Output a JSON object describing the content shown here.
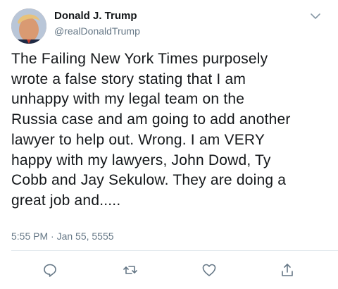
{
  "tweet": {
    "author": {
      "display_name": "Donald J. Trump",
      "handle": "@realDonaldTrump"
    },
    "text": "The Failing New York Times purposely\nwrote a false story stating that I am\nunhappy with my legal team on the\nRussia case and am going to add another\nlawyer to help out. Wrong. I am VERY\nhappy with my lawyers, John Dowd, Ty\nCobb and Jay Sekulow. They are doing a\ngreat job and.....",
    "timestamp": "5:55 PM · Jan 55, 5555"
  },
  "icons": {
    "menu": "chevron-down-icon",
    "reply": "reply-icon",
    "retweet": "retweet-icon",
    "like": "like-icon",
    "share": "share-icon"
  },
  "colors": {
    "text": "#14171a",
    "secondary": "#657786",
    "icon": "#657786",
    "divider": "#e1e8ed",
    "background": "#ffffff"
  }
}
